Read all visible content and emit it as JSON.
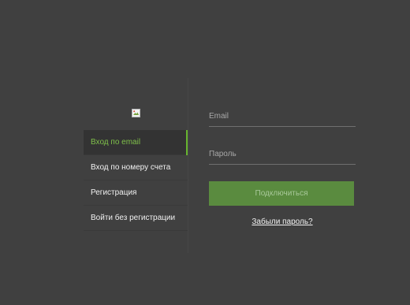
{
  "nav": {
    "items": [
      {
        "label": "Вход по email",
        "active": true
      },
      {
        "label": "Вход по номеру счета",
        "active": false
      },
      {
        "label": "Регистрация",
        "active": false
      },
      {
        "label": "Войти без регистрации",
        "active": false
      }
    ]
  },
  "form": {
    "email_placeholder": "Email",
    "password_placeholder": "Пароль",
    "connect_label": "Подключиться",
    "forgot_label": "Забыли пароль?"
  },
  "colors": {
    "background": "#404040",
    "accent": "#67b52f",
    "button": "#5a8b3f"
  }
}
